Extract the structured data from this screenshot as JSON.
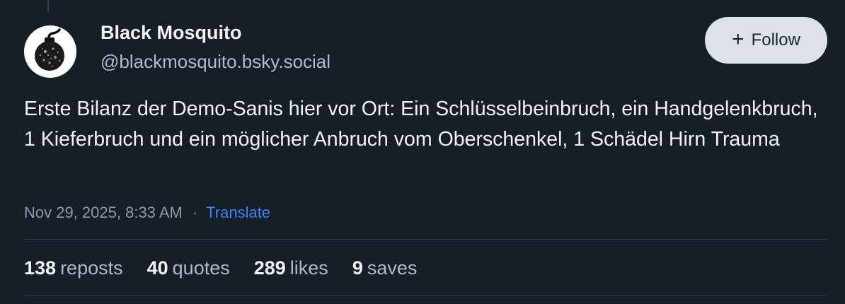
{
  "author": {
    "display_name": "Black Mosquito",
    "handle": "@blackmosquito.bsky.social",
    "avatar_icon": "bomb-icon"
  },
  "follow_button": {
    "icon": "plus-icon",
    "icon_glyph": "+",
    "label": "Follow"
  },
  "post": {
    "text": "Erste Bilanz der Demo-Sanis hier vor Ort: Ein Schlüsselbeinbruch, ein Handgelenkbruch, 1 Kieferbruch und ein möglicher Anbruch vom Oberschenkel, 1 Schädel Hirn Trauma",
    "timestamp": "Nov 29, 2025, 8:33 AM",
    "separator": "·",
    "translate_label": "Translate"
  },
  "stats": {
    "reposts": {
      "count": "138",
      "label": "reposts"
    },
    "quotes": {
      "count": "40",
      "label": "quotes"
    },
    "likes": {
      "count": "289",
      "label": "likes"
    },
    "saves": {
      "count": "9",
      "label": "saves"
    }
  },
  "colors": {
    "background": "#161e27",
    "text": "#f1f3f5",
    "secondary_text": "#aebbc9",
    "link": "#3b86f0",
    "follow_button_bg": "#dce2ea"
  }
}
